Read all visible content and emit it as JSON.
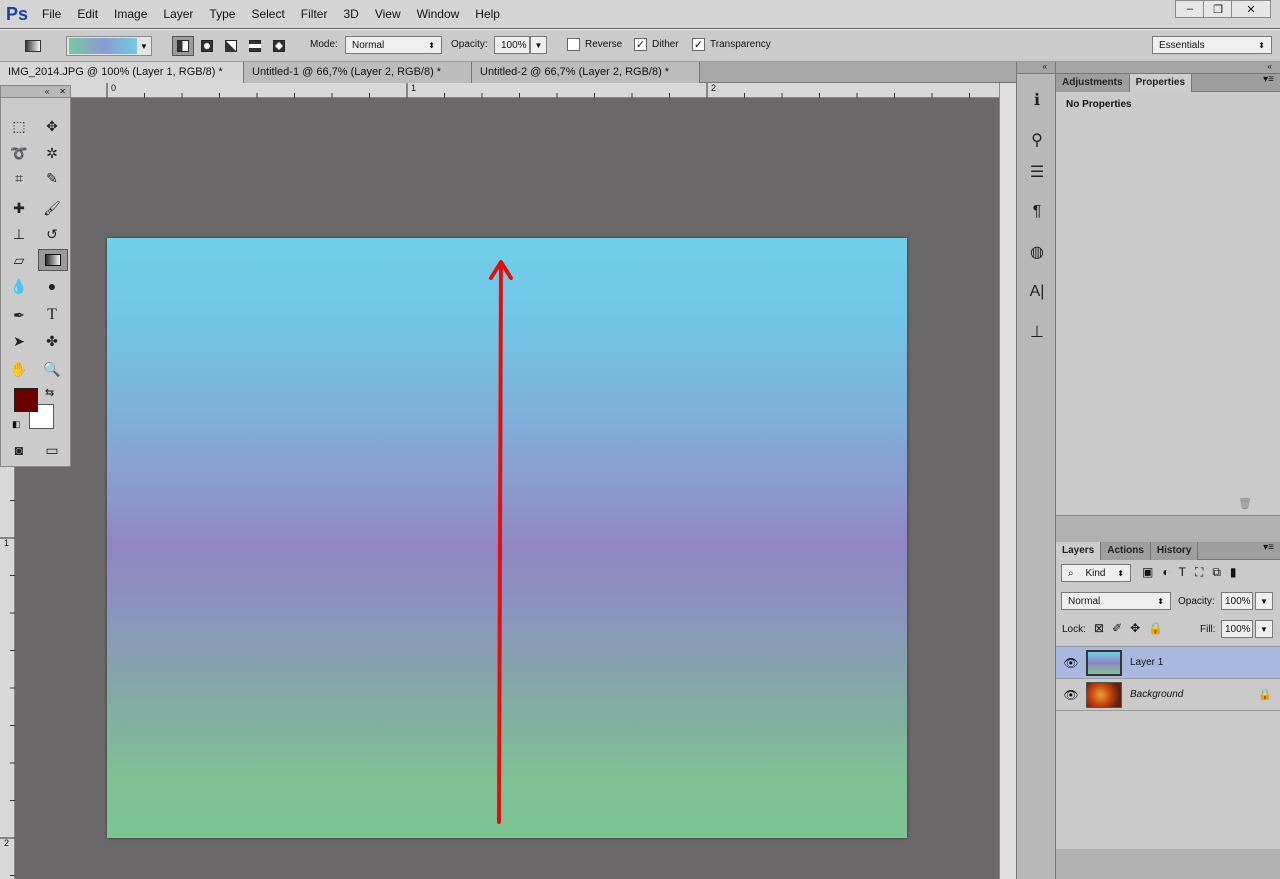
{
  "app": {
    "logo": "Ps"
  },
  "menu": [
    "File",
    "Edit",
    "Image",
    "Layer",
    "Type",
    "Select",
    "Filter",
    "3D",
    "View",
    "Window",
    "Help"
  ],
  "window_controls": {
    "minimize": "–",
    "restore": "❐",
    "close": "✕"
  },
  "options": {
    "mode_label": "Mode:",
    "mode_value": "Normal",
    "opacity_label": "Opacity:",
    "opacity_value": "100%",
    "reverse_label": "Reverse",
    "reverse_checked": false,
    "dither_label": "Dither",
    "dither_checked": true,
    "transparency_label": "Transparency",
    "transparency_checked": true,
    "workspace": "Essentials",
    "gradient_colors": [
      "#78c8a4",
      "#8a9ad0",
      "#74c8e4"
    ]
  },
  "doc_tabs": [
    {
      "label": "IMG_2014.JPG @ 100% (Layer 1, RGB/8) *",
      "active": true
    },
    {
      "label": "Untitled-1 @ 66,7% (Layer 2, RGB/8) *",
      "active": false
    },
    {
      "label": "Untitled-2 @ 66,7% (Layer 2, RGB/8) *",
      "active": false
    }
  ],
  "ruler": {
    "h": [
      "0",
      "1",
      "2"
    ],
    "v": [
      "1",
      "2"
    ]
  },
  "colors": {
    "foreground": "#6b0000",
    "background": "#ffffff",
    "arrow": "#e01010",
    "selection": "#a8b8e0"
  },
  "properties_panel": {
    "tabs": [
      "Adjustments",
      "Properties"
    ],
    "active_tab": "Properties",
    "message": "No Properties"
  },
  "layers_panel": {
    "tabs": [
      "Layers",
      "Actions",
      "History"
    ],
    "active_tab": "Layers",
    "filter_kind": "Kind",
    "blend_mode": "Normal",
    "opacity_label": "Opacity:",
    "opacity_value": "100%",
    "lock_label": "Lock:",
    "fill_label": "Fill:",
    "fill_value": "100%",
    "layers": [
      {
        "name": "Layer 1",
        "selected": true,
        "locked": false
      },
      {
        "name": "Background",
        "selected": false,
        "locked": true
      }
    ]
  }
}
